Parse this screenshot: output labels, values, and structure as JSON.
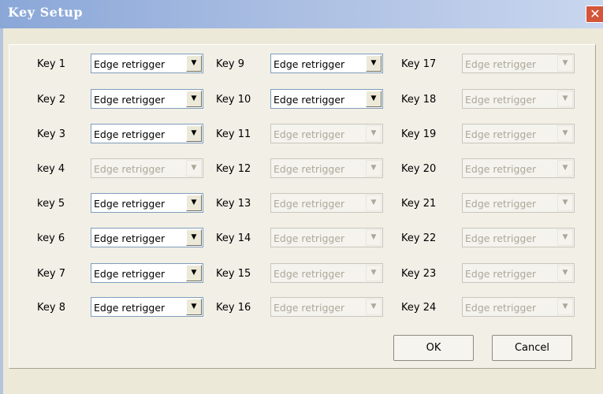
{
  "window": {
    "title": "Key Setup",
    "close_glyph": "✕"
  },
  "combo_arrow_glyph": "▼",
  "keys": [
    {
      "label": "Key 1",
      "value": "Edge retrigger",
      "enabled": true
    },
    {
      "label": "Key 2",
      "value": "Edge retrigger",
      "enabled": true
    },
    {
      "label": "Key 3",
      "value": "Edge retrigger",
      "enabled": true
    },
    {
      "label": "key 4",
      "value": "Edge retrigger",
      "enabled": false
    },
    {
      "label": "key 5",
      "value": "Edge retrigger",
      "enabled": true
    },
    {
      "label": "key 6",
      "value": "Edge retrigger",
      "enabled": true
    },
    {
      "label": "Key 7",
      "value": "Edge retrigger",
      "enabled": true
    },
    {
      "label": "Key 8",
      "value": "Edge retrigger",
      "enabled": true
    },
    {
      "label": "Key 9",
      "value": "Edge retrigger",
      "enabled": true
    },
    {
      "label": "Key 10",
      "value": "Edge retrigger",
      "enabled": true
    },
    {
      "label": "Key 11",
      "value": "Edge retrigger",
      "enabled": false
    },
    {
      "label": "Key 12",
      "value": "Edge retrigger",
      "enabled": false
    },
    {
      "label": "Key 13",
      "value": "Edge retrigger",
      "enabled": false
    },
    {
      "label": "Key 14",
      "value": "Edge retrigger",
      "enabled": false
    },
    {
      "label": "Key 15",
      "value": "Edge retrigger",
      "enabled": false
    },
    {
      "label": "Key 16",
      "value": "Edge retrigger",
      "enabled": false
    },
    {
      "label": "Key 17",
      "value": "Edge retrigger",
      "enabled": false
    },
    {
      "label": "Key 18",
      "value": "Edge retrigger",
      "enabled": false
    },
    {
      "label": "Key 19",
      "value": "Edge retrigger",
      "enabled": false
    },
    {
      "label": "Key 20",
      "value": "Edge retrigger",
      "enabled": false
    },
    {
      "label": "Key 21",
      "value": "Edge retrigger",
      "enabled": false
    },
    {
      "label": "Key 22",
      "value": "Edge retrigger",
      "enabled": false
    },
    {
      "label": "Key 23",
      "value": "Edge retrigger",
      "enabled": false
    },
    {
      "label": "Key 24",
      "value": "Edge retrigger",
      "enabled": false
    }
  ],
  "buttons": {
    "ok": "OK",
    "cancel": "Cancel"
  }
}
